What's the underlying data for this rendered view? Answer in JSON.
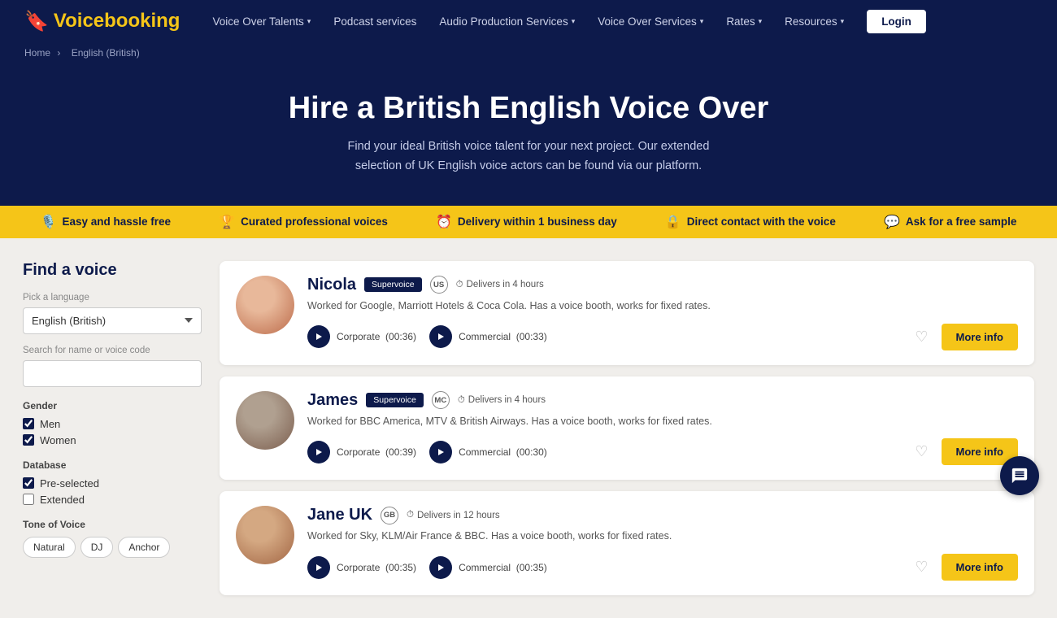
{
  "nav": {
    "logo": "Voicebooking",
    "logo_icon": "🔖",
    "links": [
      {
        "label": "Voice Over Talents",
        "has_dropdown": true
      },
      {
        "label": "Podcast services",
        "has_dropdown": false
      },
      {
        "label": "Audio Production Services",
        "has_dropdown": true
      },
      {
        "label": "Voice Over Services",
        "has_dropdown": true
      },
      {
        "label": "Rates",
        "has_dropdown": true
      },
      {
        "label": "Resources",
        "has_dropdown": true
      }
    ],
    "login_label": "Login"
  },
  "breadcrumb": {
    "home": "Home",
    "separator": "›",
    "current": "English (British)"
  },
  "hero": {
    "title": "Hire a British English Voice Over",
    "description": "Find your ideal British voice talent for your next project. Our extended selection of UK English voice actors can be found via our platform."
  },
  "features": [
    {
      "icon": "🎙️",
      "label": "Easy and hassle free"
    },
    {
      "icon": "🏆",
      "label": "Curated professional voices"
    },
    {
      "icon": "⏰",
      "label": "Delivery within 1 business day"
    },
    {
      "icon": "🔒",
      "label": "Direct contact with the voice"
    },
    {
      "icon": "💬",
      "label": "Ask for a free sample"
    }
  ],
  "sidebar": {
    "title": "Find a voice",
    "language_label": "Pick a language",
    "language_value": "English (British)",
    "search_label": "Search for name or voice code",
    "search_placeholder": "",
    "gender_label": "Gender",
    "genders": [
      {
        "label": "Men",
        "checked": true
      },
      {
        "label": "Women",
        "checked": true
      }
    ],
    "database_label": "Database",
    "databases": [
      {
        "label": "Pre-selected",
        "checked": true
      },
      {
        "label": "Extended",
        "checked": false
      }
    ],
    "tone_label": "Tone of Voice",
    "tones": [
      {
        "label": "Natural",
        "active": false
      },
      {
        "label": "DJ",
        "active": false
      },
      {
        "label": "Anchor",
        "active": false
      }
    ]
  },
  "voices": [
    {
      "id": "nicola",
      "name": "Nicola",
      "badge": "Supervoice",
      "location": "US",
      "delivers": "Delivers in 4 hours",
      "description": "Worked for Google, Marriott Hotels & Coca Cola. Has a voice booth, works for fixed rates.",
      "samples": [
        {
          "type": "Corporate",
          "duration": "00:36"
        },
        {
          "type": "Commercial",
          "duration": "00:33"
        }
      ]
    },
    {
      "id": "james",
      "name": "James",
      "badge": "Supervoice",
      "location": "MC",
      "delivers": "Delivers in 4 hours",
      "description": "Worked for BBC America, MTV & British Airways. Has a voice booth, works for fixed rates.",
      "samples": [
        {
          "type": "Corporate",
          "duration": "00:39"
        },
        {
          "type": "Commercial",
          "duration": "00:30"
        }
      ]
    },
    {
      "id": "jane",
      "name": "Jane UK",
      "badge": null,
      "location": "GB",
      "delivers": "Delivers in 12 hours",
      "description": "Worked for Sky, KLM/Air France & BBC. Has a voice booth, works for fixed rates.",
      "samples": [
        {
          "type": "Corporate",
          "duration": "00:35"
        },
        {
          "type": "Commercial",
          "duration": "00:35"
        }
      ]
    }
  ],
  "more_info_label": "More info"
}
